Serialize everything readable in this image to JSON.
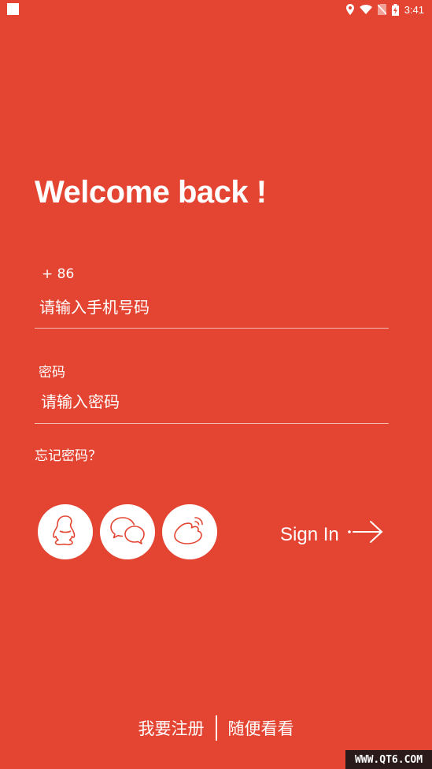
{
  "status_bar": {
    "time": "3:41",
    "icons": [
      "location-icon",
      "wifi-icon",
      "no-sim-icon",
      "battery-charging-icon"
    ]
  },
  "welcome_title": "Welcome back !",
  "phone": {
    "prefix": "+ 86",
    "placeholder": "请输入手机号码"
  },
  "password": {
    "label": "密码",
    "placeholder": "请输入密码"
  },
  "forgot_password": "忘记密码？",
  "social_logins": [
    "qq-icon",
    "wechat-icon",
    "weibo-icon"
  ],
  "sign_in_label": "Sign In",
  "bottom_links": {
    "register": "我要注册",
    "browse": "随便看看"
  },
  "watermark": "WWW.QT6.COM",
  "colors": {
    "background": "#e44532",
    "text": "#ffffff",
    "icon_stroke": "#e44532"
  }
}
